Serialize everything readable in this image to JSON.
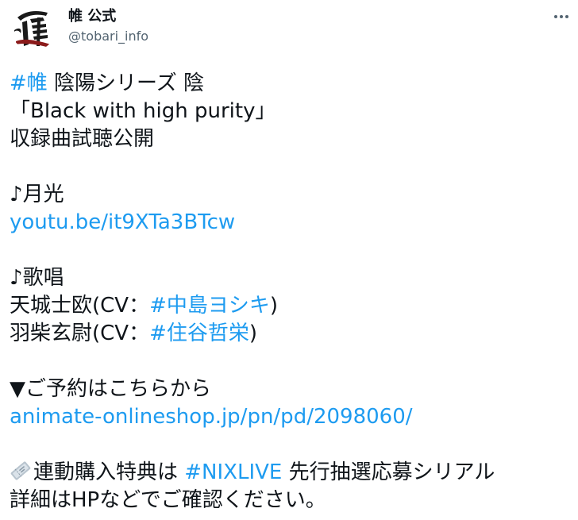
{
  "account": {
    "display_name": "帷 公式",
    "handle": "@tobari_info",
    "avatar_glyph": "帷"
  },
  "tweet": {
    "hashtag_tobari": "#帷",
    "line1_rest": " 陰陽シリーズ 陰",
    "line2": "「Black with high purity」",
    "line3": "収録曲試聴公開",
    "track1": "♪月光",
    "link1": "youtu.be/it9XTa3BTcw",
    "track2": "♪歌唱",
    "singer1_prefix": "天城士欧(CV：",
    "singer1_tag": "#中島ヨシキ",
    "singer1_suffix": ")",
    "singer2_prefix": "羽柴玄尉(CV：",
    "singer2_tag": "#住谷哲栄",
    "singer2_suffix": ")",
    "reserve": "▼ご予約はこちらから",
    "link2": "animate-onlineshop.jp/pn/pd/2098060/",
    "bonus_prefix": "連動購入特典は ",
    "bonus_tag": "#NIXLIVE",
    "bonus_suffix": " 先行抽選応募シリアル",
    "last_line": "詳細はHPなどでご確認ください。"
  },
  "colors": {
    "link": "#1d9bf0",
    "text": "#0f1419",
    "secondary": "#536471"
  },
  "icons": {
    "more": "more-options-icon",
    "ticket": "ticket-icon"
  }
}
